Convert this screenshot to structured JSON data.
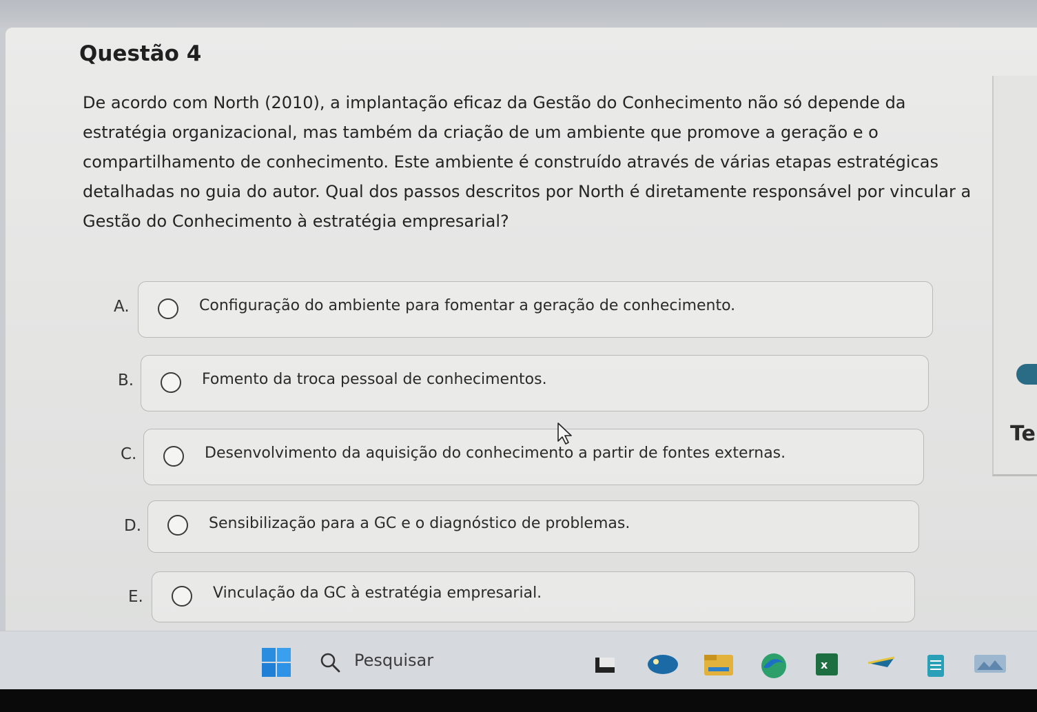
{
  "question": {
    "title": "Questão 4",
    "text": "De acordo com North (2010), a implantação eficaz da Gestão do Conhecimento não só depende da estratégia organizacional, mas também da criação de um ambiente que promove a geração e o compartilhamento de conhecimento. Este ambiente é construído através de várias etapas estratégicas detalhadas no guia do autor. Qual dos passos descritos por North é diretamente responsável por vincular a Gestão do Conhecimento à estratégia empresarial?"
  },
  "options": [
    {
      "letter": "A.",
      "label": "Configuração do ambiente para fomentar a geração de conhecimento."
    },
    {
      "letter": "B.",
      "label": "Fomento da troca pessoal de conhecimentos."
    },
    {
      "letter": "C.",
      "label": "Desenvolvimento da aquisição do conhecimento a partir de fontes externas."
    },
    {
      "letter": "D.",
      "label": "Sensibilização para a GC e o diagnóstico de problemas."
    },
    {
      "letter": "E.",
      "label": "Vinculação da GC à estratégia empresarial."
    }
  ],
  "side_panel": {
    "partial_text": "Te"
  },
  "taskbar": {
    "search_label": "Pesquisar",
    "apps": [
      "window-app-icon",
      "browser-app-icon",
      "file-explorer-icon",
      "edge-icon",
      "excel-icon",
      "pen-app-icon",
      "notes-app-icon",
      "image-app-icon"
    ]
  },
  "colors": {
    "accent": "#2a6b86",
    "windows_blue": "#1e90e8",
    "excel_green": "#1d6f42"
  }
}
